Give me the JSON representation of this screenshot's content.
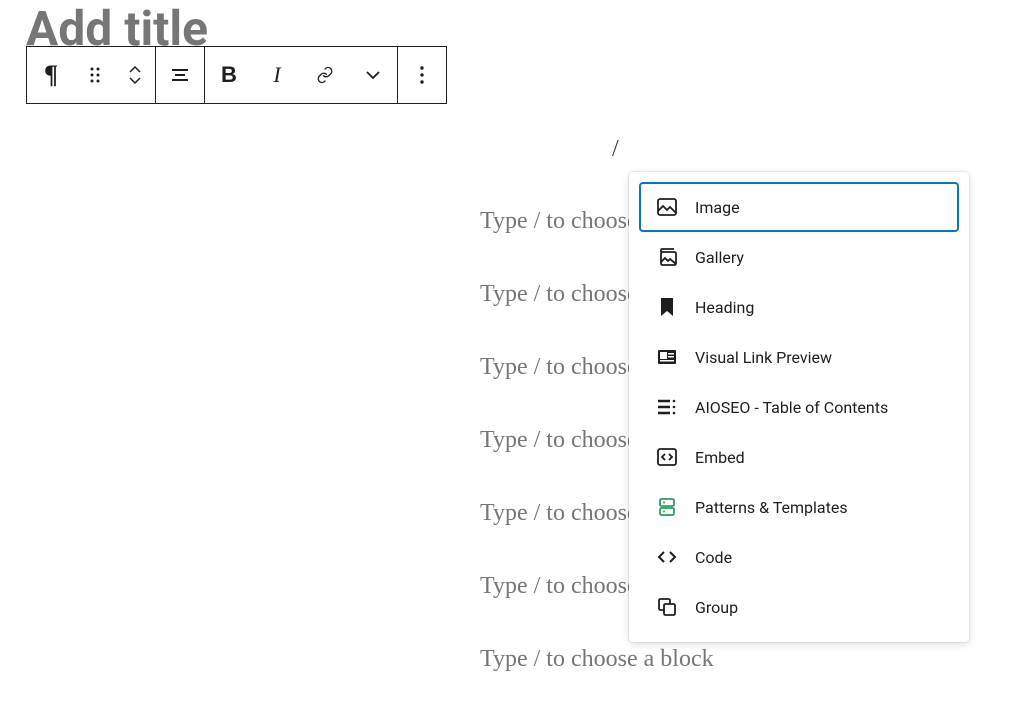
{
  "title_placeholder": "Add title",
  "toolbar": {
    "block_type": "Paragraph",
    "drag": "Drag",
    "move": "Move up/down",
    "align": "Align",
    "bold": "B",
    "italic": "I",
    "link": "Link",
    "more_rich": "More",
    "options": "Options"
  },
  "slash_char": "/",
  "block_prompt": "Type / to choose a block",
  "inserter": {
    "items": [
      {
        "label": "Image",
        "icon": "image-icon",
        "selected": true
      },
      {
        "label": "Gallery",
        "icon": "gallery-icon",
        "selected": false
      },
      {
        "label": "Heading",
        "icon": "heading-icon",
        "selected": false
      },
      {
        "label": "Visual Link Preview",
        "icon": "visual-link-preview-icon",
        "selected": false
      },
      {
        "label": "AIOSEO - Table of Contents",
        "icon": "toc-icon",
        "selected": false
      },
      {
        "label": "Embed",
        "icon": "embed-icon",
        "selected": false
      },
      {
        "label": "Patterns & Templates",
        "icon": "patterns-icon",
        "selected": false
      },
      {
        "label": "Code",
        "icon": "code-icon",
        "selected": false
      },
      {
        "label": "Group",
        "icon": "group-icon",
        "selected": false
      }
    ]
  }
}
